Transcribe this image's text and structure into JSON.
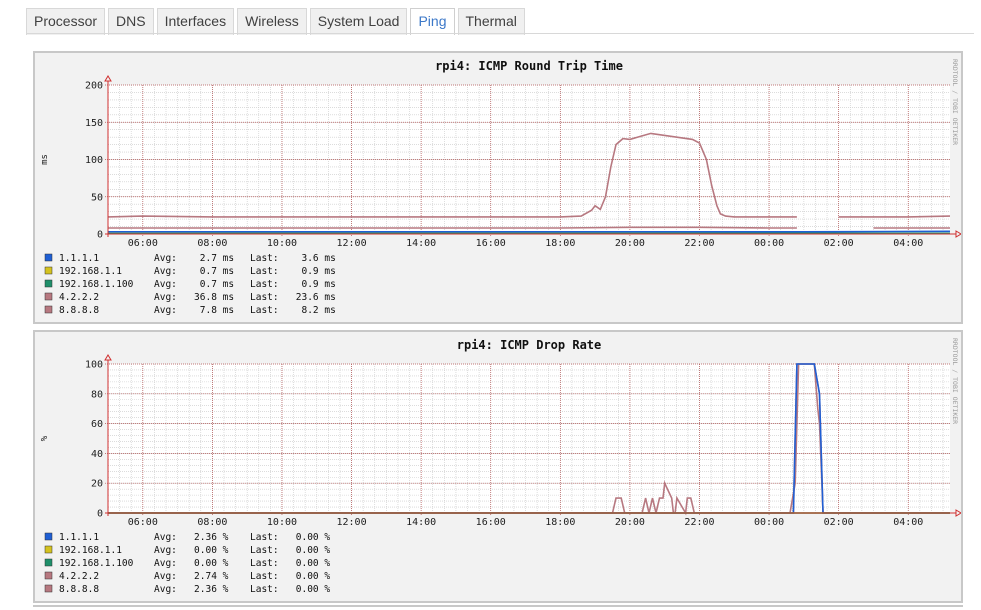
{
  "tabs": [
    {
      "label": "Processor",
      "active": false
    },
    {
      "label": "DNS",
      "active": false
    },
    {
      "label": "Interfaces",
      "active": false
    },
    {
      "label": "Wireless",
      "active": false
    },
    {
      "label": "System Load",
      "active": false
    },
    {
      "label": "Ping",
      "active": true
    },
    {
      "label": "Thermal",
      "active": false
    }
  ],
  "watermark": "RRDTOOL / TOBI OETIKER",
  "colors": {
    "1.1.1.1": "#1f5fd4",
    "192.168.1.1": "#d4c21f",
    "192.168.1.100": "#1f8f6a",
    "4.2.2.2": "#b77880",
    "8.8.8.8": "#b77880",
    "grid_minor": "#c8c8c8",
    "grid_major": "#b05050",
    "axis": "#d03030"
  },
  "chart_data": [
    {
      "type": "line",
      "title": "rpi4: ICMP Round Trip Time",
      "ylabel": "ms",
      "ylim": [
        0,
        200
      ],
      "yticks": [
        0,
        50,
        100,
        150,
        200
      ],
      "xticks": [
        "06:00",
        "08:00",
        "10:00",
        "12:00",
        "14:00",
        "16:00",
        "18:00",
        "20:00",
        "22:00",
        "00:00",
        "02:00",
        "04:00"
      ],
      "xlim": [
        5.0,
        29.2
      ],
      "grid": true,
      "legend": [
        {
          "name": "1.1.1.1",
          "avg": "Avg:    2.7 ms",
          "last": "Last:    3.6 ms"
        },
        {
          "name": "192.168.1.1",
          "avg": "Avg:    0.7 ms",
          "last": "Last:    0.9 ms"
        },
        {
          "name": "192.168.1.100",
          "avg": "Avg:    0.7 ms",
          "last": "Last:    0.9 ms"
        },
        {
          "name": "4.2.2.2",
          "avg": "Avg:   36.8 ms",
          "last": "Last:   23.6 ms"
        },
        {
          "name": "8.8.8.8",
          "avg": "Avg:    7.8 ms",
          "last": "Last:    8.2 ms"
        }
      ],
      "series": [
        {
          "name": "4.2.2.2",
          "x": [
            5.0,
            6.0,
            8.0,
            10.0,
            12.0,
            14.0,
            16.0,
            17.0,
            18.0,
            18.6,
            18.9,
            19.0,
            19.15,
            19.3,
            19.45,
            19.6,
            19.8,
            20.0,
            20.3,
            20.6,
            20.9,
            21.2,
            21.5,
            21.8,
            22.0,
            22.2,
            22.35,
            22.5,
            22.6,
            22.75,
            23.0,
            24.0,
            24.8,
            25.3,
            26.0,
            27.0,
            28.0,
            29.2
          ],
          "y": [
            23,
            24,
            23,
            23,
            23,
            23,
            23,
            23,
            23,
            24,
            32,
            38,
            33,
            50,
            90,
            120,
            128,
            127,
            131,
            135,
            133,
            131,
            129,
            127,
            122,
            100,
            65,
            38,
            27,
            24,
            23,
            23,
            23,
            null,
            23,
            23,
            23,
            24
          ]
        },
        {
          "name": "8.8.8.8",
          "x": [
            5.0,
            8.0,
            12.0,
            16.0,
            18.0,
            20.0,
            22.0,
            24.0,
            24.8,
            25.3,
            27.0,
            29.2
          ],
          "y": [
            8,
            8,
            8,
            8,
            8,
            9,
            9,
            8,
            8,
            null,
            8,
            8
          ]
        },
        {
          "name": "1.1.1.1",
          "x": [
            5.0,
            10.0,
            15.0,
            20.0,
            25.0,
            29.2
          ],
          "y": [
            3,
            3,
            3,
            3,
            3,
            3.6
          ]
        },
        {
          "name": "192.168.1.1",
          "x": [
            5.0,
            29.2
          ],
          "y": [
            0.7,
            0.9
          ]
        },
        {
          "name": "192.168.1.100",
          "x": [
            5.0,
            29.2
          ],
          "y": [
            0.7,
            0.9
          ]
        }
      ]
    },
    {
      "type": "line",
      "title": "rpi4: ICMP Drop Rate",
      "ylabel": "%",
      "ylim": [
        0,
        100
      ],
      "yticks": [
        0,
        20,
        40,
        60,
        80,
        100
      ],
      "xticks": [
        "06:00",
        "08:00",
        "10:00",
        "12:00",
        "14:00",
        "16:00",
        "18:00",
        "20:00",
        "22:00",
        "00:00",
        "02:00",
        "04:00"
      ],
      "xlim": [
        5.0,
        29.2
      ],
      "grid": true,
      "legend": [
        {
          "name": "1.1.1.1",
          "avg": "Avg:   2.36 %",
          "last": "Last:   0.00 %"
        },
        {
          "name": "192.168.1.1",
          "avg": "Avg:   0.00 %",
          "last": "Last:   0.00 %"
        },
        {
          "name": "192.168.1.100",
          "avg": "Avg:   0.00 %",
          "last": "Last:   0.00 %"
        },
        {
          "name": "4.2.2.2",
          "avg": "Avg:   2.74 %",
          "last": "Last:   0.00 %"
        },
        {
          "name": "8.8.8.8",
          "avg": "Avg:   2.36 %",
          "last": "Last:   0.00 %"
        }
      ],
      "series": [
        {
          "name": "4.2.2.2",
          "x": [
            5.0,
            19.5,
            19.6,
            19.75,
            19.85,
            20.35,
            20.45,
            20.55,
            20.65,
            20.75,
            20.85,
            20.95,
            21.0,
            21.1,
            21.2,
            21.25,
            21.3,
            21.35,
            21.6,
            21.65,
            21.75,
            21.85,
            24.6,
            24.75,
            24.85,
            25.3,
            25.4,
            25.45,
            25.5,
            25.55,
            29.2
          ],
          "y": [
            0,
            0,
            10,
            10,
            0,
            0,
            10,
            0,
            10,
            0,
            10,
            10,
            20,
            15,
            10,
            0,
            0,
            10,
            0,
            10,
            10,
            0,
            0,
            20,
            100,
            100,
            70,
            60,
            30,
            0,
            0
          ]
        },
        {
          "name": "8.8.8.8",
          "x": [
            5.0,
            24.7,
            24.8,
            25.3,
            25.45,
            25.55,
            29.2
          ],
          "y": [
            0,
            0,
            100,
            100,
            80,
            0,
            0
          ]
        },
        {
          "name": "1.1.1.1",
          "x": [
            5.0,
            24.7,
            24.8,
            25.3,
            25.45,
            25.55,
            29.2
          ],
          "y": [
            0,
            0,
            100,
            100,
            80,
            0,
            0
          ]
        },
        {
          "name": "192.168.1.1",
          "x": [
            5.0,
            29.2
          ],
          "y": [
            0,
            0
          ]
        },
        {
          "name": "192.168.1.100",
          "x": [
            5.0,
            29.2
          ],
          "y": [
            0,
            0
          ]
        }
      ]
    }
  ]
}
